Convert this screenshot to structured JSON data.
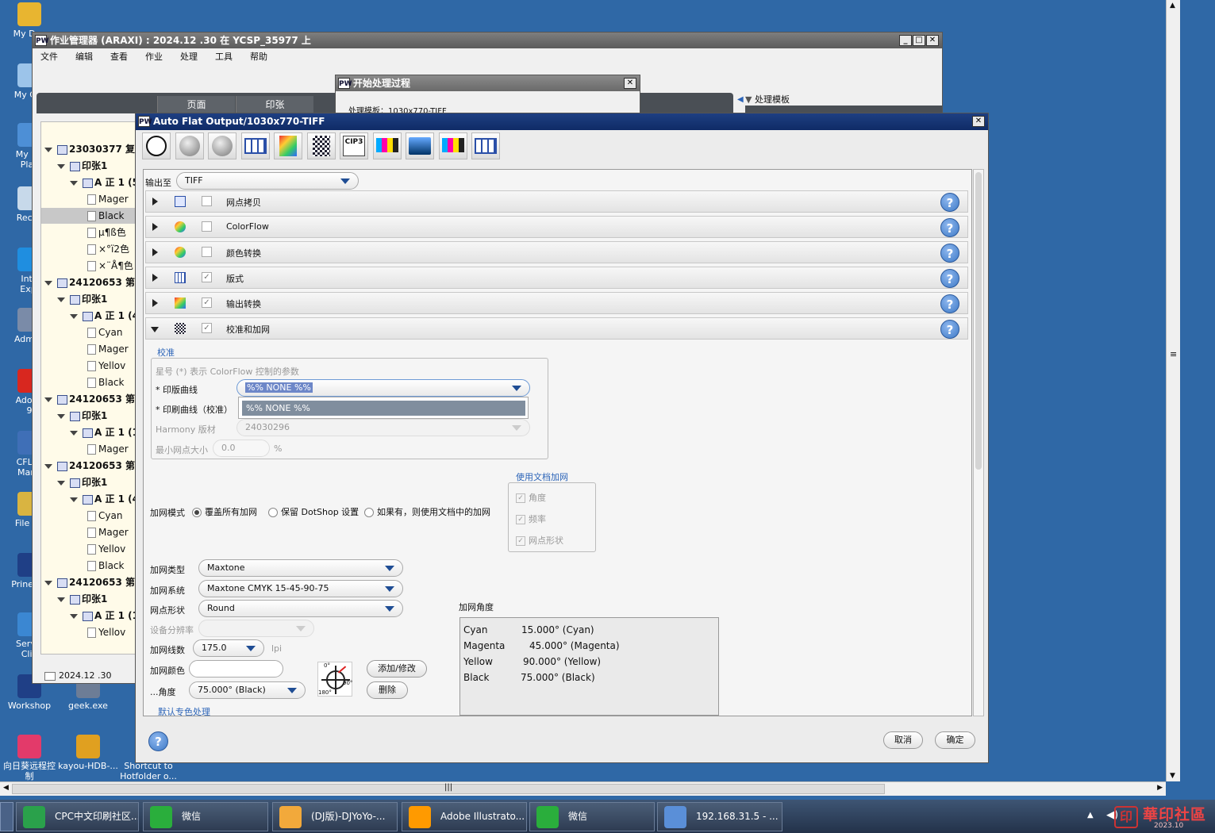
{
  "desktop": {
    "icons": [
      {
        "label": "My Doc",
        "color": "#e8b530"
      },
      {
        "label": "My Cor",
        "color": "#9cc4ea"
      },
      {
        "label": "My Ne\nPlac",
        "color": "#4d8fd6"
      },
      {
        "label": "Recyc",
        "color": "#c7d9ea"
      },
      {
        "label": "Inte\nExpl",
        "color": "#1f8ee0"
      },
      {
        "label": "Admini",
        "color": "#7a8ba8"
      },
      {
        "label": "Adobe\n9",
        "color": "#d8271f"
      },
      {
        "label": "CFL Li\nMana",
        "color": "#3f6fb7"
      },
      {
        "label": "File Co",
        "color": "#d9b441"
      },
      {
        "label": "Prinergy",
        "color": "#1f3f86"
      },
      {
        "label": "Servic\nClie",
        "color": "#3b87d2"
      },
      {
        "label": "Workshop",
        "color": "#1f3f86"
      },
      {
        "label": "geek.exe",
        "color": "#6d7d96"
      },
      {
        "label": "向日葵远程控\n制",
        "color": "#e33a6a"
      },
      {
        "label": "kayou-HDB-...",
        "color": "#e0a020"
      },
      {
        "label": "Shortcut to\nHotfolder o...",
        "color": "#e8c15a"
      }
    ]
  },
  "job_manager": {
    "title": "作业管理器 (ARAXI) : 2024.12 .30 在 YCSP_35977 上",
    "menu": [
      "文件",
      "编辑",
      "查看",
      "作业",
      "处理",
      "工具",
      "帮助"
    ],
    "tabs": [
      "页面",
      "印张"
    ],
    "process_template_label": "处理模板",
    "footer_date": "2024.12 .30",
    "tree": [
      {
        "level": 0,
        "type": "job",
        "label": "23030377 复方"
      },
      {
        "level": 1,
        "type": "box",
        "label": "印张1"
      },
      {
        "level": 2,
        "type": "box",
        "label": "A 正 1 (5"
      },
      {
        "level": 3,
        "type": "page",
        "label": "Mager"
      },
      {
        "level": 3,
        "type": "page",
        "label": "Black",
        "selected": true
      },
      {
        "level": 3,
        "type": "page",
        "label": "µ¶ß色"
      },
      {
        "level": 3,
        "type": "page",
        "label": "×°ï2色"
      },
      {
        "level": 3,
        "type": "page",
        "label": "×¨Å¶色"
      },
      {
        "level": 0,
        "type": "job",
        "label": "24120653 第五"
      },
      {
        "level": 1,
        "type": "box",
        "label": "印张1"
      },
      {
        "level": 2,
        "type": "box",
        "label": "A 正 1 (4"
      },
      {
        "level": 3,
        "type": "page",
        "label": "Cyan"
      },
      {
        "level": 3,
        "type": "page",
        "label": "Mager"
      },
      {
        "level": 3,
        "type": "page",
        "label": "Yellov"
      },
      {
        "level": 3,
        "type": "page",
        "label": "Black"
      },
      {
        "level": 0,
        "type": "job",
        "label": "24120653 第五"
      },
      {
        "level": 1,
        "type": "box",
        "label": "印张1"
      },
      {
        "level": 2,
        "type": "box",
        "label": "A 正 1 (1"
      },
      {
        "level": 3,
        "type": "page",
        "label": "Mager"
      },
      {
        "level": 0,
        "type": "job",
        "label": "24120653 第五"
      },
      {
        "level": 1,
        "type": "box",
        "label": "印张1"
      },
      {
        "level": 2,
        "type": "box",
        "label": "A 正 1 (4"
      },
      {
        "level": 3,
        "type": "page",
        "label": "Cyan"
      },
      {
        "level": 3,
        "type": "page",
        "label": "Mager"
      },
      {
        "level": 3,
        "type": "page",
        "label": "Yellov"
      },
      {
        "level": 3,
        "type": "page",
        "label": "Black"
      },
      {
        "level": 0,
        "type": "job",
        "label": "24120653 第五"
      },
      {
        "level": 1,
        "type": "box",
        "label": "印张1"
      },
      {
        "level": 2,
        "type": "box",
        "label": "A 正 1 (1"
      },
      {
        "level": 3,
        "type": "page",
        "label": "Yellov"
      }
    ]
  },
  "start_process": {
    "title": "开始处理过程",
    "template_text": "处理模板：1030x770-TIFF"
  },
  "dialog": {
    "title": "Auto Flat Output/1030x770-TIFF",
    "output_to_label": "输出至",
    "output_to_value": "TIFF",
    "sections": [
      {
        "label": "网点拷贝",
        "checked": false,
        "expanded": false
      },
      {
        "label": "ColorFlow",
        "checked": false,
        "expanded": false
      },
      {
        "label": "颜色转换",
        "checked": false,
        "expanded": false
      },
      {
        "label": "版式",
        "checked": true,
        "expanded": false
      },
      {
        "label": "输出转换",
        "checked": true,
        "expanded": false
      },
      {
        "label": "校准和加网",
        "checked": true,
        "expanded": true
      }
    ],
    "calib": {
      "group_title": "校准",
      "note": "星号 (*) 表示 ColorFlow 控制的参数",
      "plate_curve_label": "* 印版曲线",
      "plate_curve_value": "%% NONE %%",
      "print_curve_label": "* 印刷曲线（校准）",
      "dropdown_option": "%% NONE %%",
      "harmony_label": "Harmony 版材",
      "harmony_value": "24030296",
      "min_dot_label": "最小网点大小",
      "min_dot_value": "0.0",
      "min_dot_unit": "%"
    },
    "doc_screen": {
      "title": "使用文档加网",
      "items": [
        "角度",
        "频率",
        "网点形状"
      ]
    },
    "screen_mode": {
      "label": "加网模式",
      "options": [
        "覆盖所有加网",
        "保留 DotShop 设置",
        "如果有，则使用文档中的加网"
      ],
      "selected_index": 0
    },
    "fields": {
      "screen_type_label": "加网类型",
      "screen_type_value": "Maxtone",
      "screen_system_label": "加网系统",
      "screen_system_value": "Maxtone CMYK 15-45-90-75",
      "dot_shape_label": "网点形状",
      "dot_shape_value": "Round",
      "device_res_label": "设备分辨率",
      "lpi_label": "加网线数",
      "lpi_value": "175.0",
      "lpi_unit": "lpi",
      "screen_color_label": "加网颜色",
      "angle_label": "...角度",
      "angle_value": "75.000° (Black)",
      "add_modify": "添加/修改",
      "delete": "删除",
      "dial_labels": [
        "0°",
        "90°",
        "180°"
      ],
      "default_spot": "默认专色处理"
    },
    "angles": {
      "title": "加网角度",
      "rows": [
        {
          "ink": "Cyan",
          "angle": "15.000° (Cyan)"
        },
        {
          "ink": "Magenta",
          "angle": "45.000° (Magenta)"
        },
        {
          "ink": "Yellow",
          "angle": "90.000° (Yellow)"
        },
        {
          "ink": "Black",
          "angle": "75.000° (Black)"
        }
      ]
    },
    "cancel_label": "取消",
    "ok_label": "确定"
  },
  "taskbar": {
    "items": [
      {
        "label": "CPC中文印刷社区...",
        "color": "#2aa14b"
      },
      {
        "label": "微信",
        "color": "#2aae3c"
      },
      {
        "label": "(DJ版)-DJYoYo-...",
        "color": "#f2a93b"
      },
      {
        "label": "Adobe Illustrato...",
        "color": "#ff9a00"
      },
      {
        "label": "微信",
        "color": "#2aae3c"
      },
      {
        "label": "192.168.31.5 - ...",
        "color": "#5a8fd8"
      }
    ],
    "watermark": "華印社區",
    "watermark_sub": "2023.10"
  }
}
